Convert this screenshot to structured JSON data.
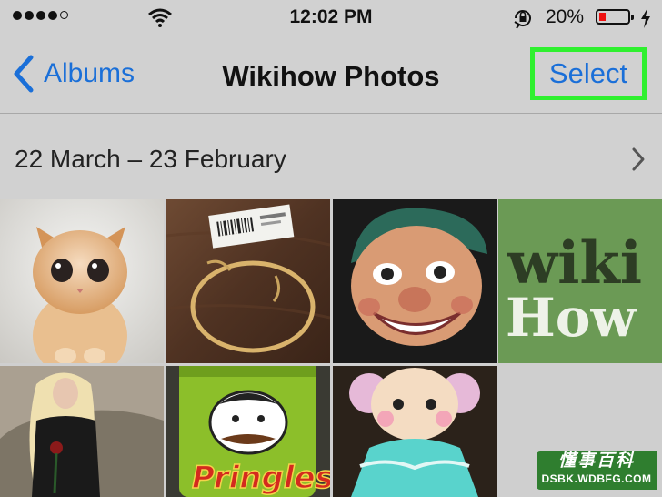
{
  "status_bar": {
    "time": "12:02 PM",
    "battery_percent": "20%",
    "signal_bars_filled": 4,
    "signal_bars_total": 5
  },
  "nav": {
    "back_label": "Albums",
    "title": "Wikihow Photos",
    "select_label": "Select"
  },
  "section": {
    "date_range": "22 March – 23 February"
  },
  "photos": [
    {
      "subject": "kitten"
    },
    {
      "subject": "bracelet-with-tag"
    },
    {
      "subject": "dummy-puppet"
    },
    {
      "subject": "wikihow-logo",
      "logo_line1": "wiki",
      "logo_line2": "How"
    },
    {
      "subject": "woman-with-rose"
    },
    {
      "subject": "pringles-can",
      "brand_text": "Pringles"
    },
    {
      "subject": "doll"
    }
  ],
  "watermark": {
    "line1": "懂事百科",
    "line2": "DSBK.WDBFG.COM"
  },
  "colors": {
    "accent": "#1a6fd8",
    "highlight": "#2ff02f",
    "wikihow_green": "#6b9a55"
  }
}
